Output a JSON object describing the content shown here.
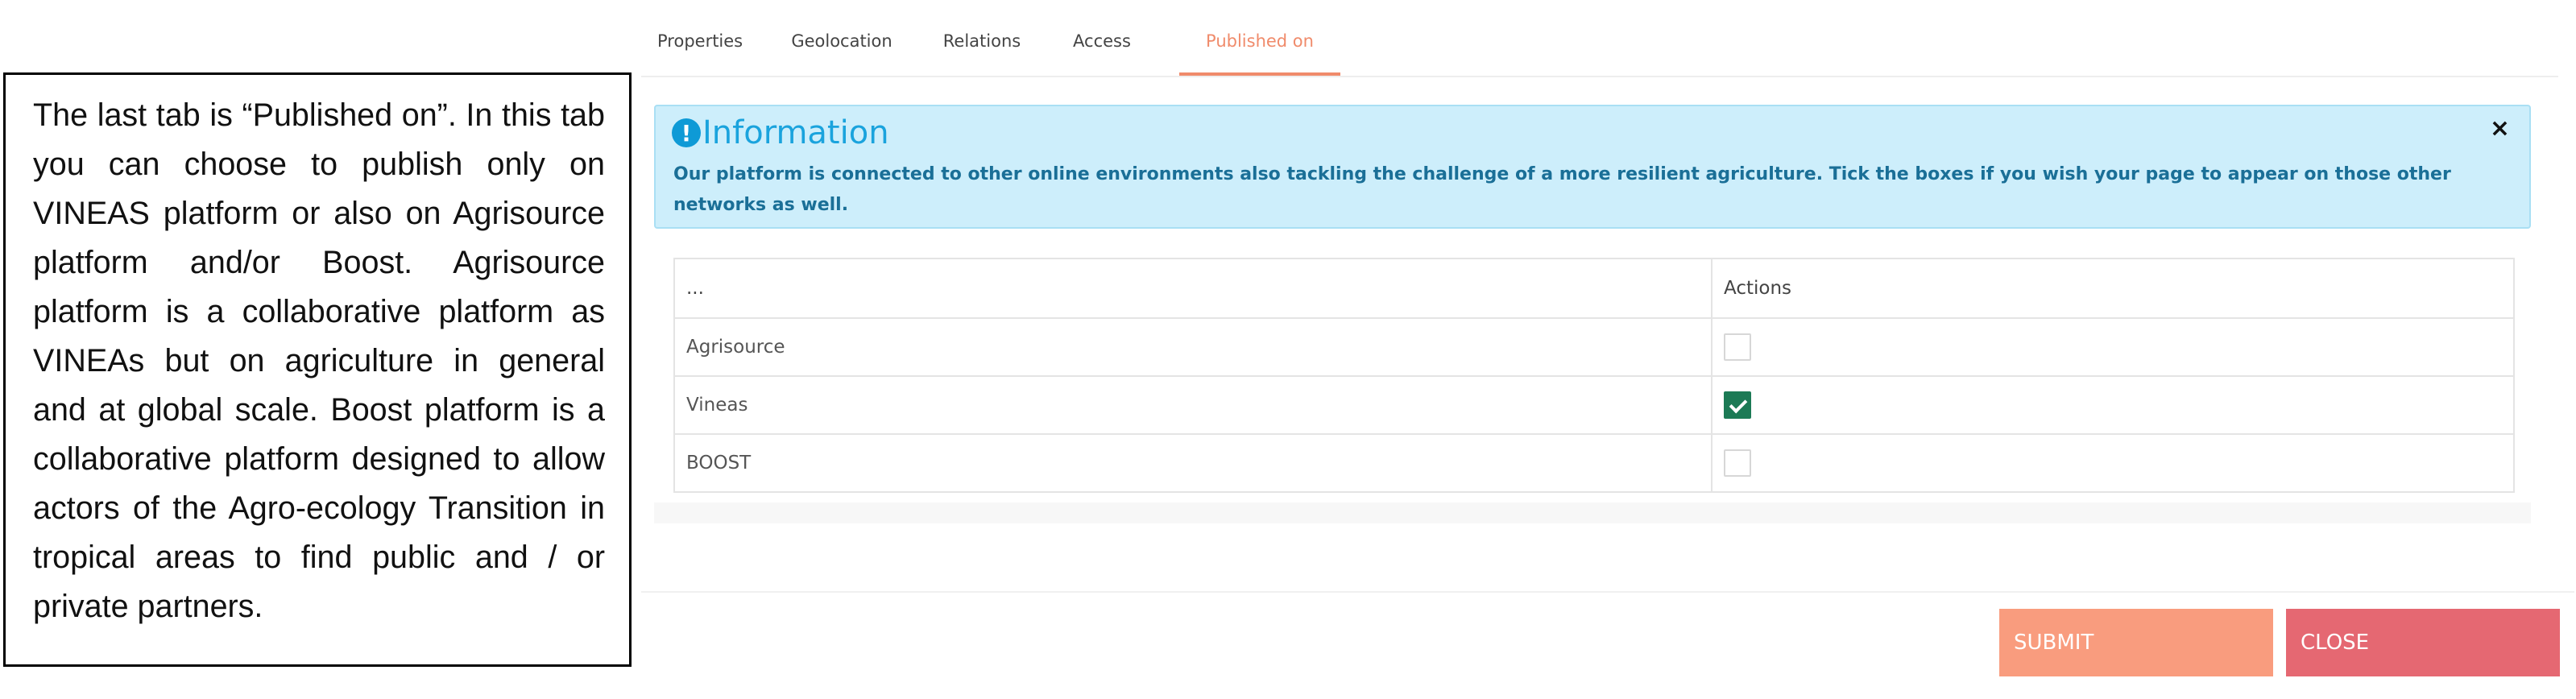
{
  "callout": {
    "text": "The last tab is “Published on”. In this tab you can choose to publish only on VINEAS platform or also on Agrisource platform and/or Boost. Agrisource platform is a collaborative platform as VINEAs but on agriculture in general and at global scale. Boost platform is a collaborative platform designed to allow actors of the Agro-ecology Transition in tropical areas to find public and / or private partners."
  },
  "tabs": [
    {
      "label": "Properties"
    },
    {
      "label": "Geolocation"
    },
    {
      "label": "Relations"
    },
    {
      "label": "Access"
    },
    {
      "label": "Published on"
    }
  ],
  "alert": {
    "icon": "exclamation-icon",
    "title": "Information",
    "close": "×",
    "text": "Our platform is connected to other online environments also tackling the challenge of a more resilient agriculture. Tick the boxes if you wish your page to appear on those other networks as well."
  },
  "table": {
    "headers": [
      "...",
      "Actions"
    ],
    "rows": [
      {
        "name": "Agrisource",
        "checked": false
      },
      {
        "name": "Vineas",
        "checked": true
      },
      {
        "name": "BOOST",
        "checked": false
      }
    ]
  },
  "buttons": {
    "submit": "SUBMIT",
    "close": "CLOSE"
  },
  "colors": {
    "accent": "#f08b6b",
    "info_bg": "#cdeefb",
    "submit": "#f99c7e",
    "close": "#e56872",
    "checked": "#1c7a55"
  }
}
